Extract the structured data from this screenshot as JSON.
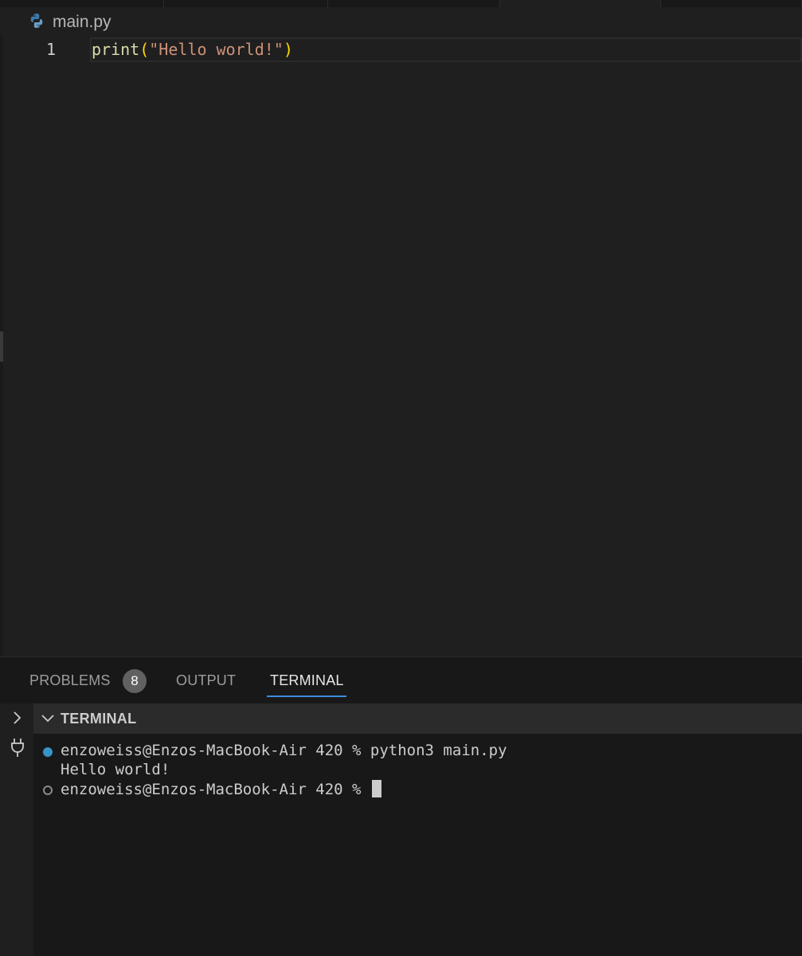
{
  "editor": {
    "breadcrumb": {
      "file_name": "main.py",
      "icon": "python-icon"
    },
    "lines": [
      {
        "number": "1",
        "tokens": {
          "fn": "print",
          "open": "(",
          "str": "\"Hello world!\"",
          "close": ")"
        }
      }
    ]
  },
  "panel": {
    "tabs": [
      {
        "label": "PROBLEMS",
        "badge": "8"
      },
      {
        "label": "OUTPUT"
      },
      {
        "label": "TERMINAL",
        "active": true
      }
    ],
    "terminal": {
      "header_title": "TERMINAL",
      "lines": [
        "enzoweiss@Enzos-MacBook-Air 420 % python3 main.py",
        "Hello world!",
        "enzoweiss@Enzos-MacBook-Air 420 % "
      ]
    }
  },
  "colors": {
    "accent": "#3c8dde",
    "string": "#ce9178",
    "function": "#dcdcaa",
    "bracket": "#ffd700",
    "status_dot": "#3794c7"
  }
}
